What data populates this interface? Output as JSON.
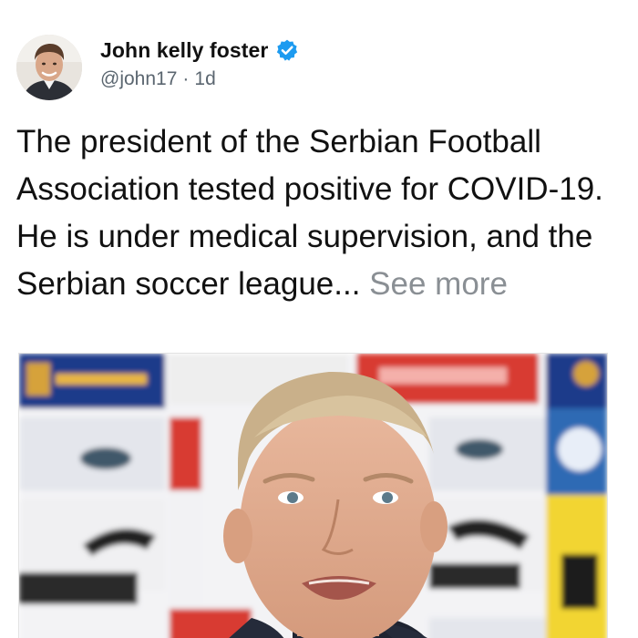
{
  "author": {
    "name": "John kelly foster",
    "handle": "@john17",
    "separator": "·",
    "time": "1d",
    "verified": true,
    "avatar_icon": "person-avatar-icon",
    "verified_icon": "verified-badge-icon",
    "verified_color": "#1d9bf0"
  },
  "post": {
    "text": "The president of the Serbian Football Association tested positive for COVID-19. He is under medical supervision, and the Serbian soccer league... ",
    "see_more": "See more",
    "text_color": "#111111",
    "see_more_color": "#8a8f94"
  },
  "media": {
    "icon": "press-conference-photo-icon"
  }
}
